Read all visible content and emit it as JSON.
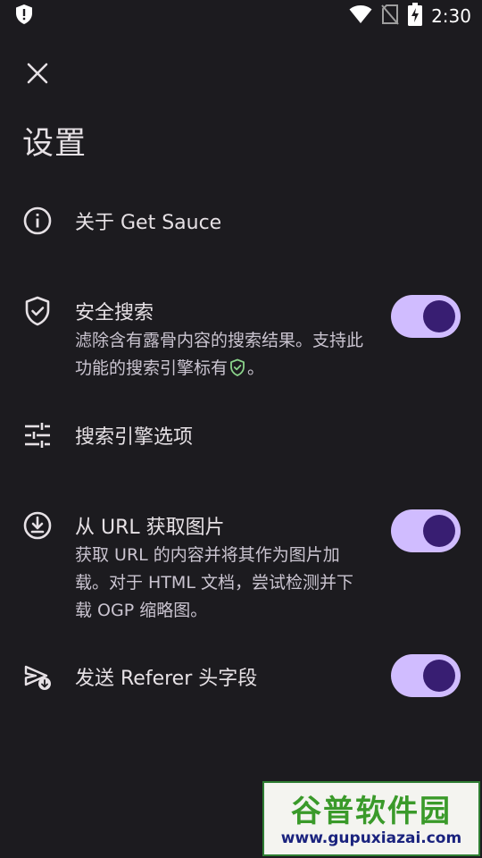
{
  "status_bar": {
    "time": "2:30"
  },
  "header": {
    "title": "设置"
  },
  "settings": {
    "about": {
      "label": "关于 Get Sauce"
    },
    "safe_search": {
      "label": "安全搜索",
      "desc_part1": "滤除含有露骨内容的搜索结果。支持此功能的搜索引擎标有",
      "desc_part2": "。",
      "enabled": true
    },
    "engine_options": {
      "label": "搜索引擎选项"
    },
    "url_fetch": {
      "label": "从 URL 获取图片",
      "desc": "获取 URL 的内容并将其作为图片加载。对于 HTML 文档，尝试检测并下载 OGP 缩略图。",
      "enabled": true
    },
    "referer": {
      "label": "发送 Referer 头字段",
      "enabled": true
    }
  },
  "watermark": {
    "title": "谷普软件园",
    "url": "www.gupuxiazai.com"
  },
  "colors": {
    "background": "#1c1b1f",
    "toggle_track": "#d0bcff",
    "toggle_knob": "#381e72",
    "shield_green": "#8bd48b"
  }
}
